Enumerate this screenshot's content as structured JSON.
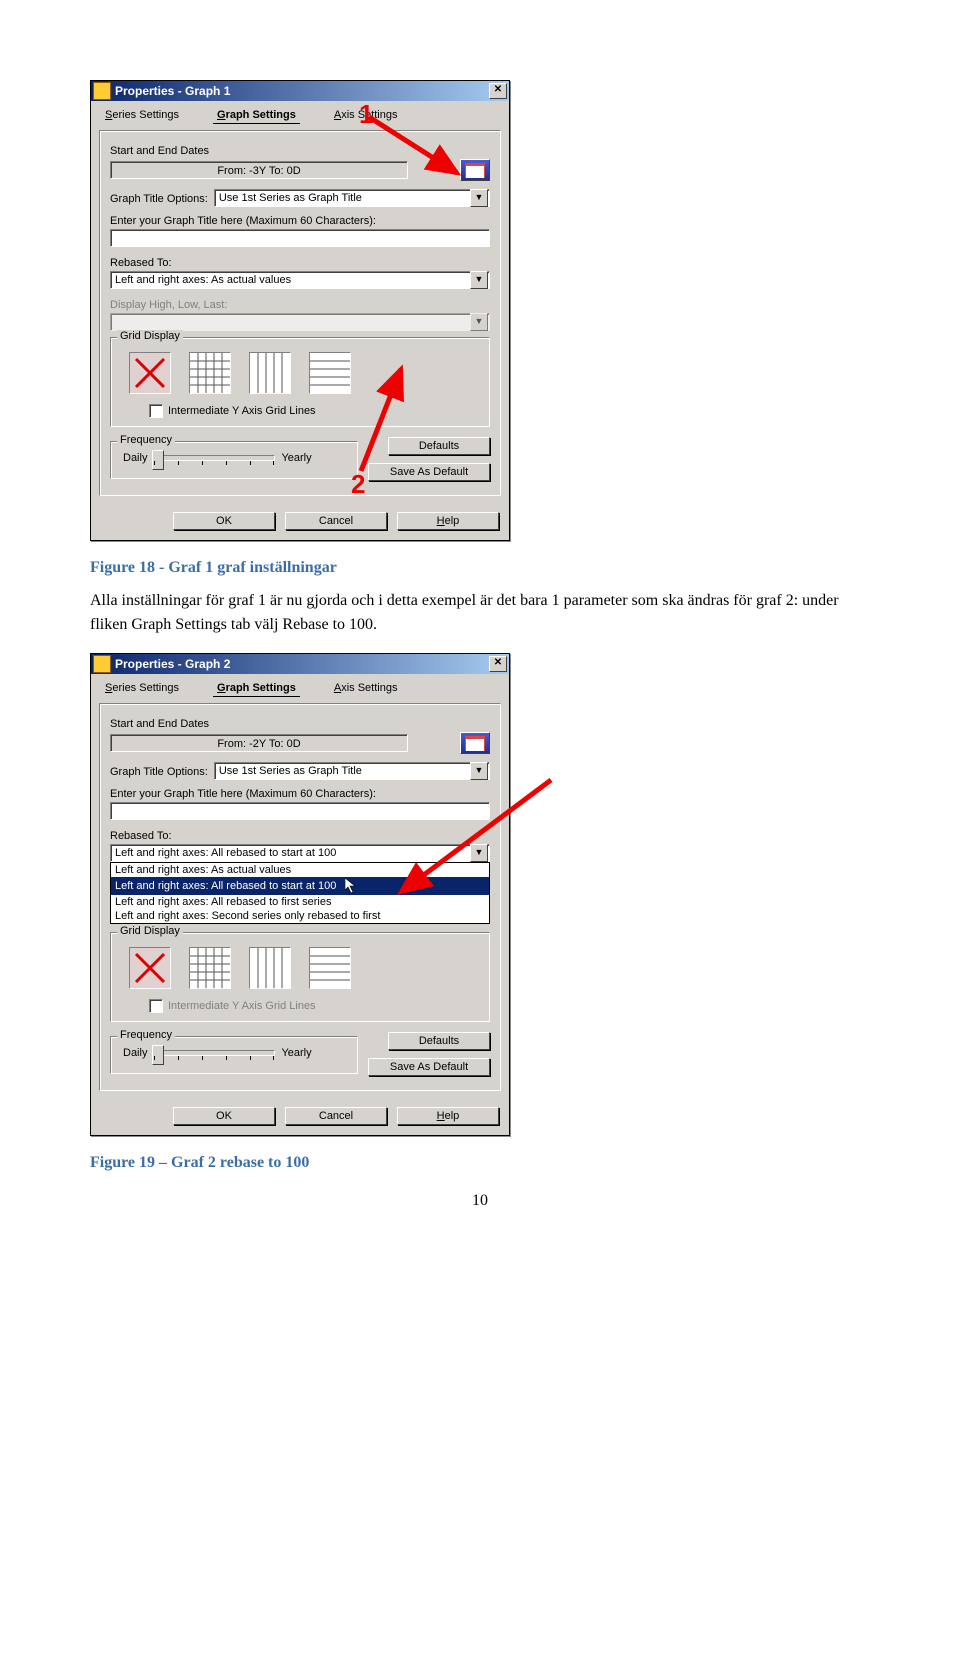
{
  "dialog1": {
    "title": "Properties - Graph 1",
    "tabs": {
      "series": "Series Settings",
      "graph": "Graph Settings",
      "axis": "Axis Settings"
    },
    "start_end_label": "Start and End Dates",
    "start_end_value": "From: -3Y To: 0D",
    "title_opts_label": "Graph Title Options:",
    "title_opts_value": "Use 1st Series as Graph Title",
    "enter_title_label": "Enter your Graph Title here (Maximum 60 Characters):",
    "enter_title_value": "",
    "rebased_label": "Rebased To:",
    "rebased_value": "Left and right axes: As actual values",
    "hilo_label": "Display High, Low, Last:",
    "hilo_value": "",
    "grid_label": "Grid Display",
    "intermediate_label": "Intermediate Y Axis Grid Lines",
    "freq_label": "Frequency",
    "freq_left": "Daily",
    "freq_right": "Yearly",
    "defaults_btn": "Defaults",
    "save_default_btn": "Save As Default",
    "ok_btn": "OK",
    "cancel_btn": "Cancel",
    "help_btn": "Help",
    "annot1": "1",
    "annot2": "2"
  },
  "caption1": "Figure 18 - Graf 1 graf inställningar",
  "bodytext": "Alla inställningar för graf 1 är nu gjorda och i detta exempel är det bara 1 parameter som ska ändras för graf 2: under fliken Graph Settings tab välj Rebase to 100.",
  "dialog2": {
    "title": "Properties - Graph 2",
    "tabs": {
      "series": "Series Settings",
      "graph": "Graph Settings",
      "axis": "Axis Settings"
    },
    "start_end_label": "Start and End Dates",
    "start_end_value": "From: -2Y To: 0D",
    "title_opts_label": "Graph Title Options:",
    "title_opts_value": "Use 1st Series as Graph Title",
    "enter_title_label": "Enter your Graph Title here (Maximum 60 Characters):",
    "enter_title_value": "",
    "rebased_label": "Rebased To:",
    "rebased_value": "Left and right axes: All rebased to start at 100",
    "rebased_options": [
      "Left and right axes: As actual values",
      "Left and right axes: All rebased to start at 100",
      "Left and right axes: All rebased to first series",
      "Left and right axes: Second series only rebased to first"
    ],
    "grid_label": "Grid Display",
    "intermediate_label": "Intermediate Y Axis Grid Lines",
    "freq_label": "Frequency",
    "freq_left": "Daily",
    "freq_right": "Yearly",
    "defaults_btn": "Defaults",
    "save_default_btn": "Save As Default",
    "ok_btn": "OK",
    "cancel_btn": "Cancel",
    "help_btn": "Help"
  },
  "caption2": "Figure 19 – Graf 2 rebase to 100",
  "page_number": "10"
}
